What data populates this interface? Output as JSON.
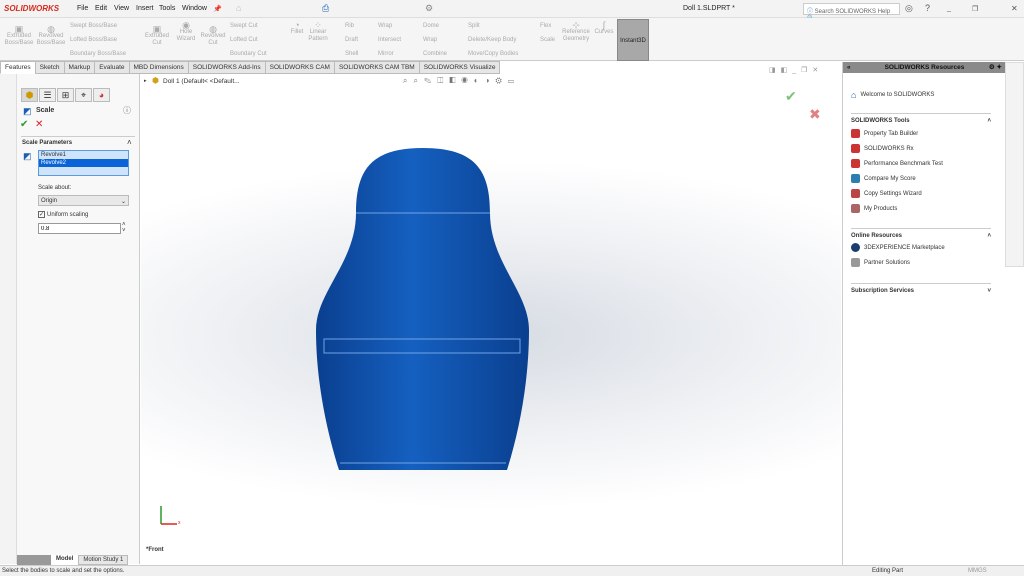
{
  "app": {
    "brand": "SOLIDWORKS",
    "document_title": "Doll 1.SLDPRT *",
    "search_placeholder": "Search SOLIDWORKS Help"
  },
  "menu": [
    "File",
    "Edit",
    "View",
    "Insert",
    "Tools",
    "Window"
  ],
  "ribbon": {
    "large": [
      {
        "label": "Extruded Boss/Base"
      },
      {
        "label": "Revolved Boss/Base"
      },
      {
        "label": "Extruded Cut"
      },
      {
        "label": "Hole Wizard"
      },
      {
        "label": "Revolved Cut"
      },
      {
        "label": "Fillet"
      },
      {
        "label": "Linear Pattern"
      },
      {
        "label": "Reference Geometry"
      },
      {
        "label": "Curves"
      }
    ],
    "small": [
      "Swept Boss/Base",
      "Lofted Boss/Base",
      "Boundary Boss/Base",
      "Swept Cut",
      "Lofted Cut",
      "Boundary Cut",
      "Rib",
      "Draft",
      "Shell",
      "Wrap",
      "Intersect",
      "Mirror",
      "Dome",
      "Wrap",
      "Combine",
      "Split",
      "Delete/Keep Body",
      "Move/Copy Bodies",
      "Flex",
      "Scale"
    ],
    "instant3d": "Instant3D"
  },
  "tabs": [
    "Features",
    "Sketch",
    "Markup",
    "Evaluate",
    "MBD Dimensions",
    "SOLIDWORKS Add-Ins",
    "SOLIDWORKS CAM",
    "SOLIDWORKS CAM TBM",
    "SOLIDWORKS Visualize"
  ],
  "property_manager": {
    "title": "Scale",
    "section": "Scale Parameters",
    "bodies": [
      "Revolve1",
      "Revolve2"
    ],
    "scale_about_label": "Scale about:",
    "scale_about_value": "Origin",
    "uniform_label": "Uniform scaling",
    "uniform_checked": true,
    "factor": "0.8"
  },
  "tree": {
    "root": "Doll 1  (Default< <Default..."
  },
  "viewport": {
    "view_label": "*Front",
    "axis_x": "x"
  },
  "resources": {
    "title": "SOLIDWORKS Resources",
    "welcome": "Welcome to SOLIDWORKS",
    "tools_title": "SOLIDWORKS Tools",
    "tools": [
      "Property Tab Builder",
      "SOLIDWORKS Rx",
      "Performance Benchmark Test",
      "Compare My Score",
      "Copy Settings Wizard",
      "My Products"
    ],
    "online_title": "Online Resources",
    "online": [
      "3DEXPERIENCE Marketplace",
      "Partner Solutions"
    ],
    "subscription_title": "Subscription Services"
  },
  "bottom_tabs": [
    "Model",
    "Motion Study 1"
  ],
  "status": {
    "message": "Select the bodies to scale and set the options.",
    "mode": "Editing Part",
    "units": "MMGS"
  },
  "colors": {
    "model": "#0d4fa8",
    "selection": "#0a64d8"
  }
}
